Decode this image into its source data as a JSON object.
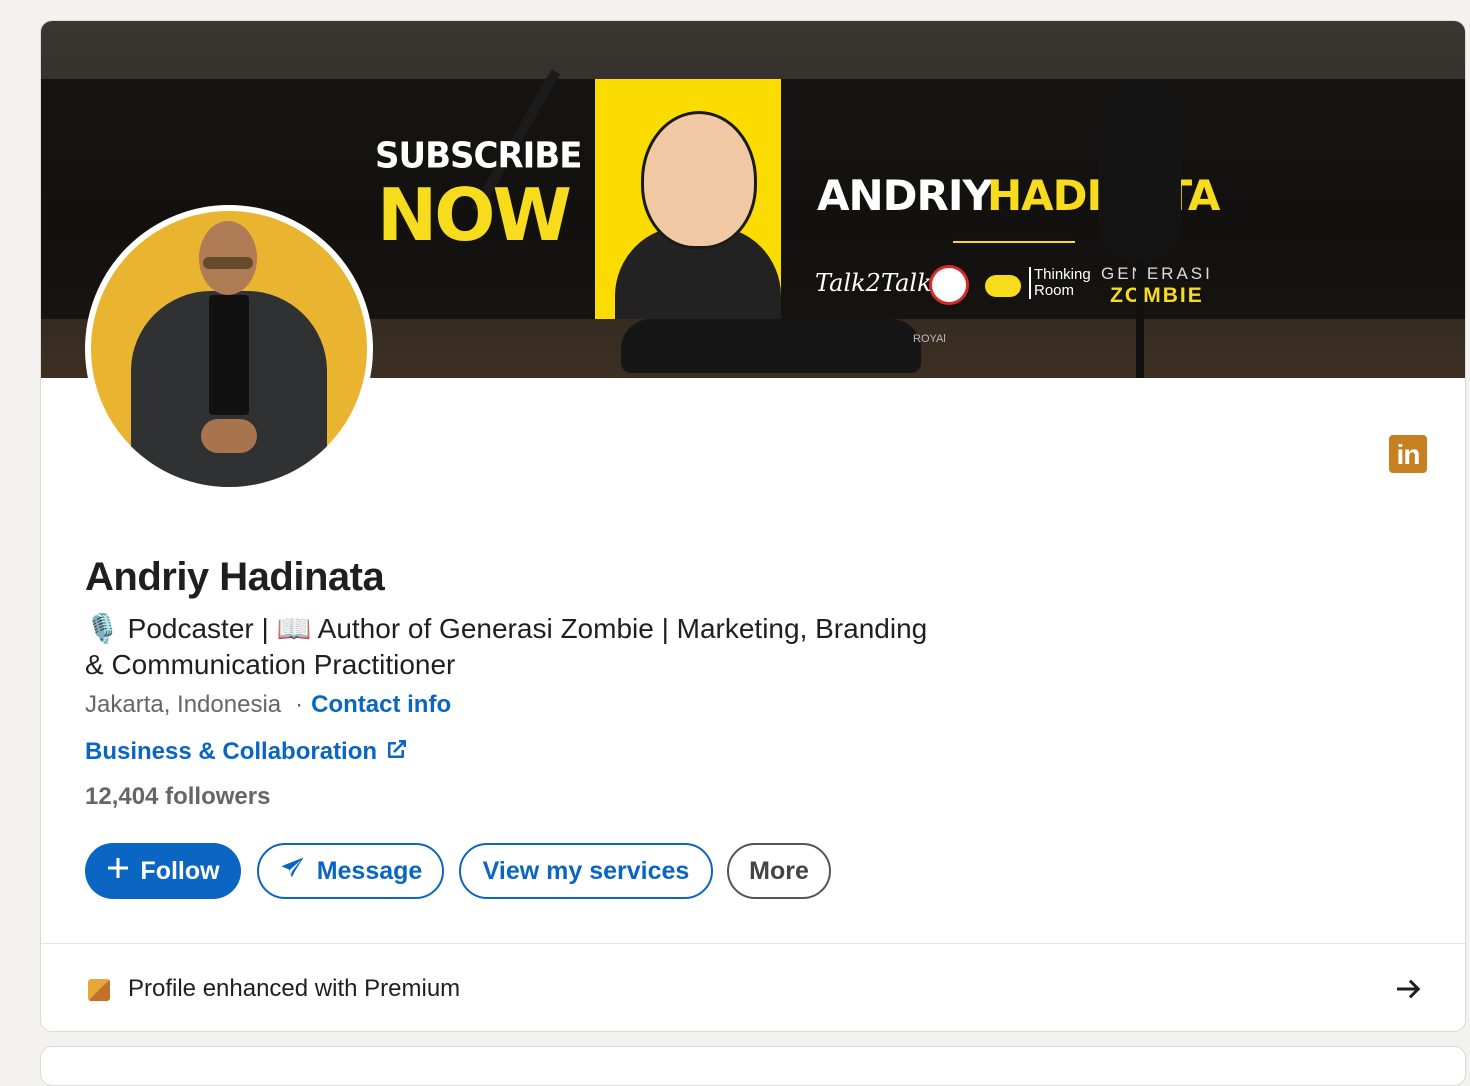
{
  "banner": {
    "subscribe": "SUBSCRIBE",
    "now": "NOW",
    "name_first": "ANDRIY",
    "name_last": "HADINATA",
    "logo_talk": "Talk2Talk",
    "logo_thinking": "Thinking Room",
    "logo_generasi": "GENERASI",
    "logo_zombie": "ZOMBIE",
    "headphone_brand": "ROYAl"
  },
  "profile": {
    "name": "Andriy Hadinata",
    "headline_line1": "🎙️ Podcaster | 📖 Author of Generasi Zombie | Marketing, Branding",
    "headline_line2": "& Communication Practitioner",
    "location": "Jakarta, Indonesia",
    "contact_info": "Contact info",
    "business_link": "Business & Collaboration",
    "followers": "12,404 followers"
  },
  "actions": {
    "follow": "Follow",
    "message": "Message",
    "view_services": "View my services",
    "more": "More"
  },
  "premium": {
    "text": "Profile enhanced with Premium"
  },
  "linkedin_badge": "in",
  "colors": {
    "accent": "#0a66c2",
    "premium_gold": "#c6801f",
    "banner_yellow": "#f7dc1d",
    "avatar_bg": "#e9b430"
  }
}
